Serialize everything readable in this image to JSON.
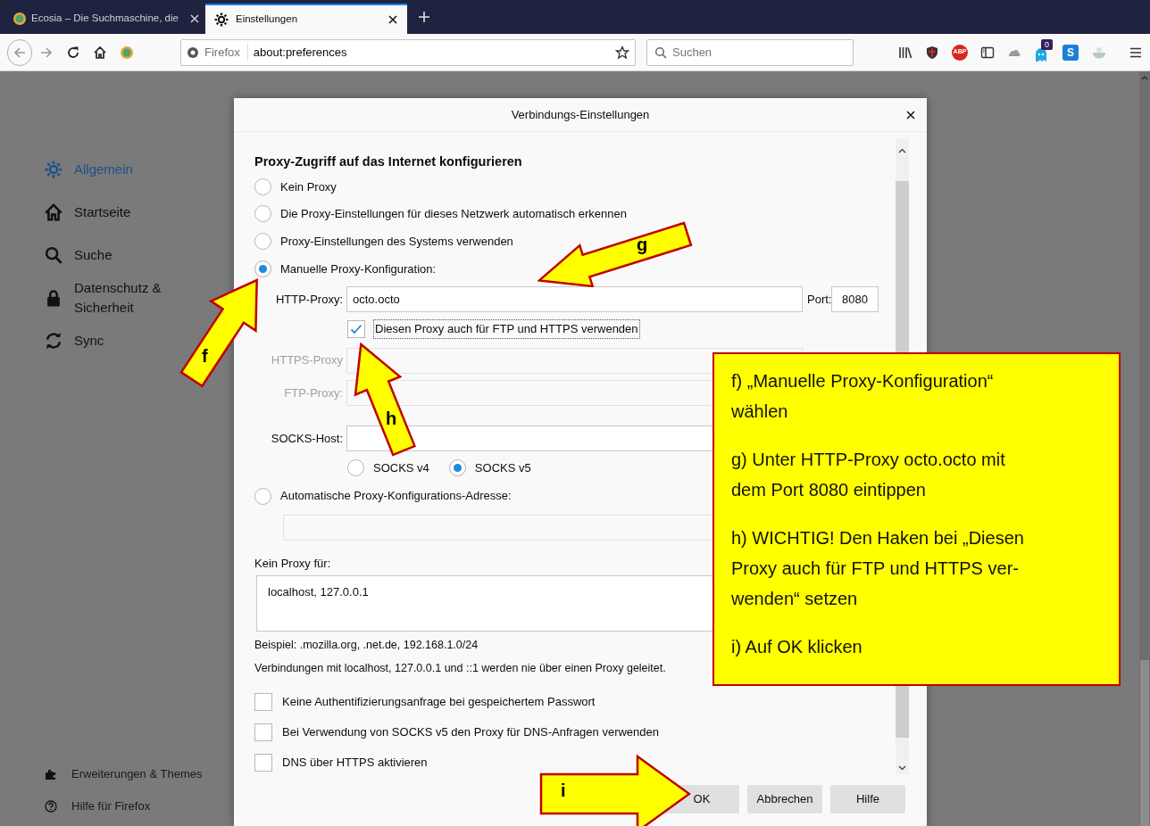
{
  "tabs": [
    {
      "label": "Ecosia – Die Suchmaschine, die",
      "selected": false
    },
    {
      "label": "Einstellungen",
      "selected": true
    }
  ],
  "address_bar": {
    "identity": "Firefox",
    "url": "about:preferences"
  },
  "search": {
    "placeholder": "Suchen"
  },
  "toolbar": {
    "adblock_label": "ABP",
    "notification_badge": "0",
    "s_extension_label": "S"
  },
  "sidebar": {
    "items": [
      {
        "label": "Allgemein",
        "selected": true
      },
      {
        "label": "Startseite",
        "selected": false
      },
      {
        "label": "Suche",
        "selected": false
      },
      {
        "label": "Datenschutz & Sicherheit",
        "selected": false
      },
      {
        "label": "Sync",
        "selected": false
      }
    ],
    "footer_links": [
      {
        "label": "Erweiterungen & Themes"
      },
      {
        "label": "Hilfe für Firefox"
      }
    ]
  },
  "dialog": {
    "title": "Verbindungs-Einstellungen",
    "heading": "Proxy-Zugriff auf das Internet konfigurieren",
    "proxy_options": [
      {
        "label": "Kein Proxy",
        "selected": false
      },
      {
        "label": "Die Proxy-Einstellungen für dieses Netzwerk automatisch erkennen",
        "selected": false
      },
      {
        "label": "Proxy-Einstellungen des Systems verwenden",
        "selected": false
      },
      {
        "label": "Manuelle Proxy-Konfiguration:",
        "selected": true
      }
    ],
    "http_proxy": {
      "label": "HTTP-Proxy:",
      "value": "octo.octo",
      "port_label": "Port:",
      "port": "8080"
    },
    "share_proxy": {
      "label": "Diesen Proxy auch für FTP und HTTPS verwenden",
      "checked": true
    },
    "https_proxy": {
      "label": "HTTPS-Proxy",
      "disabled": true
    },
    "ftp_proxy": {
      "label": "FTP-Proxy:",
      "disabled": true
    },
    "socks_host": {
      "label": "SOCKS-Host:"
    },
    "socks_versions": [
      {
        "label": "SOCKS v4",
        "selected": false
      },
      {
        "label": "SOCKS v5",
        "selected": true
      }
    ],
    "auto_config": {
      "label": "Automatische Proxy-Konfigurations-Adresse:",
      "selected": false
    },
    "no_proxy": {
      "label": "Kein Proxy für:",
      "value": "localhost, 127.0.0.1"
    },
    "hints": [
      "Beispiel: .mozilla.org, .net.de, 192.168.1.0/24",
      "Verbindungen mit localhost, 127.0.0.1 und ::1 werden nie über einen Proxy geleitet."
    ],
    "options": [
      {
        "label": "Keine Authentifizierungsanfrage bei gespeichertem Passwort",
        "checked": false
      },
      {
        "label": "Bei Verwendung von SOCKS v5 den Proxy für DNS-Anfragen verwenden",
        "checked": false
      },
      {
        "label": "DNS über HTTPS aktivieren",
        "checked": false
      }
    ],
    "buttons": [
      "OK",
      "Abbrechen",
      "Hilfe"
    ]
  },
  "annotations": {
    "arrows": [
      {
        "label": "f"
      },
      {
        "label": "g"
      },
      {
        "label": "h"
      },
      {
        "label": "i"
      }
    ],
    "note": [
      "f) „Manuelle Proxy-Konfiguration“\nwählen",
      "g) Unter HTTP-Proxy octo.octo mit\ndem Port 8080 eintippen",
      "h) WICHTIG! Den Haken bei „Diesen\nProxy auch für FTP und HTTPS ver-\nwenden“ setzen",
      "i) Auf OK klicken"
    ]
  }
}
